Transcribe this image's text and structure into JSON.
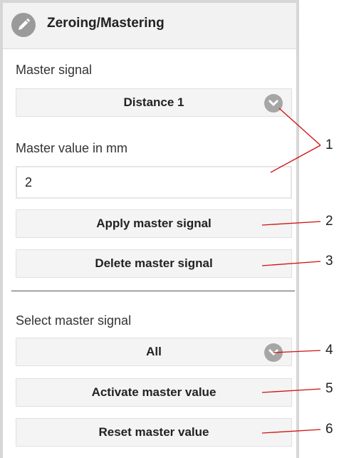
{
  "header": {
    "title": "Zeroing/Mastering",
    "icon": "pencil-icon"
  },
  "master_signal": {
    "label": "Master signal",
    "selected": "Distance 1"
  },
  "master_value": {
    "label": "Master value in mm",
    "value": "2"
  },
  "buttons": {
    "apply": "Apply master signal",
    "delete": "Delete master signal",
    "activate": "Activate master value",
    "reset": "Reset master value"
  },
  "select_master": {
    "label": "Select master signal",
    "selected": "All"
  },
  "callouts": [
    "1",
    "2",
    "3",
    "4",
    "5",
    "6"
  ],
  "colors": {
    "callout_line": "#d01010",
    "accent_grey": "#a6a6a6"
  }
}
